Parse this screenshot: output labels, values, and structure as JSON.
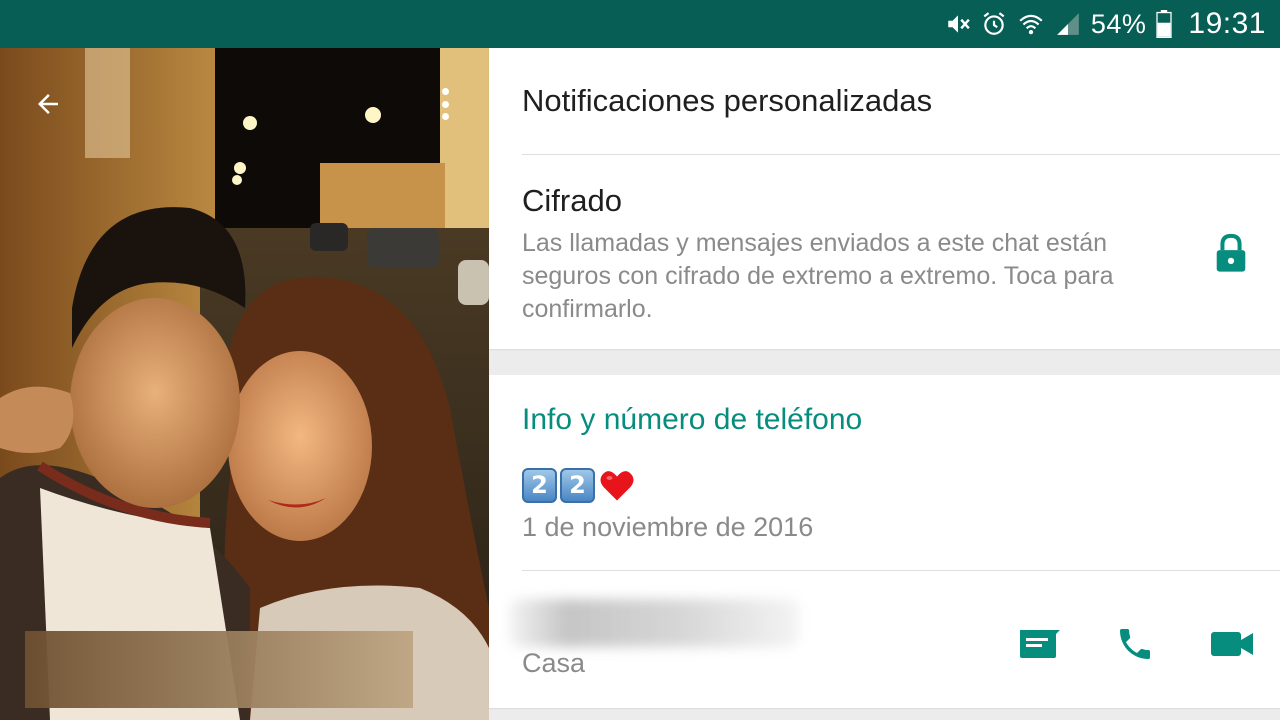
{
  "status_bar": {
    "battery": "54%",
    "time": "19:31",
    "icons": [
      "mute-icon",
      "alarm-icon",
      "wifi-icon",
      "signal-icon",
      "battery-icon"
    ]
  },
  "photo": {
    "back_icon": "arrow-back-icon",
    "menu_icon": "more-vert-icon"
  },
  "settings": {
    "custom_notifications": "Notificaciones personalizadas",
    "encryption": {
      "title": "Cifrado",
      "description": "Las llamadas y mensajes enviados a este chat están seguros con cifrado de extremo a extremo. Toca para confirmarlo.",
      "icon": "lock-icon"
    }
  },
  "info": {
    "section_title": "Info y número de teléfono",
    "about_status": [
      "2",
      "2"
    ],
    "about_heart": "heart-emoji",
    "about_date": "1 de noviembre de 2016",
    "phone_label": "Casa",
    "actions": [
      "message-icon",
      "call-icon",
      "video-call-icon"
    ]
  },
  "colors": {
    "status_bar": "#075e54",
    "accent": "#078d7e",
    "secondary_text": "#8a8a8a"
  }
}
